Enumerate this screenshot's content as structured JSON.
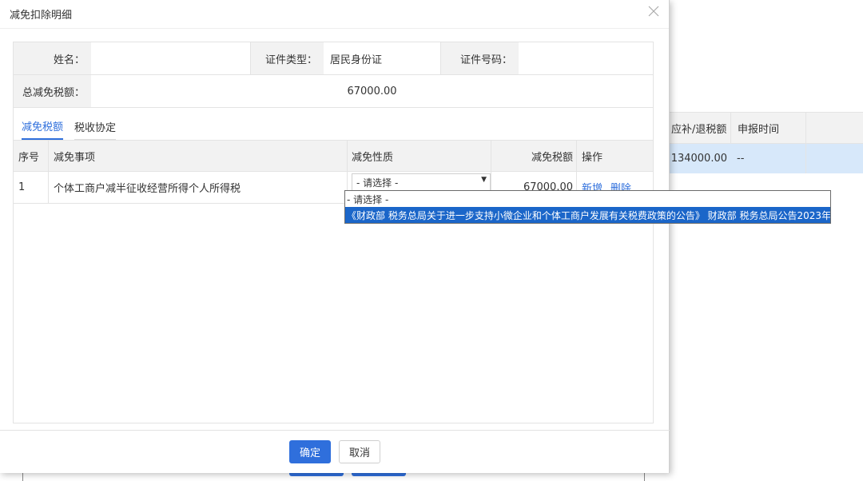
{
  "modal": {
    "title": "减免扣除明细",
    "close_glyph": "╳"
  },
  "info": {
    "name_label": "姓名：",
    "name_value": "",
    "id_type_label": "证件类型：",
    "id_type_value": "居民身份证",
    "id_no_label": "证件号码：",
    "id_no_value": "",
    "total_label": "总减免税额：",
    "total_value": "67000.00"
  },
  "tabs": [
    {
      "label": "减免税额",
      "active": true
    },
    {
      "label": "税收协定",
      "active": false
    }
  ],
  "grid": {
    "headers": {
      "no": "序号",
      "item": "减免事项",
      "type": "减免性质",
      "amount": "减免税额",
      "op": "操作"
    },
    "rows": [
      {
        "no": "1",
        "item": "个体工商户减半征收经营所得个人所得税",
        "type_selected": "- 请选择 -",
        "amount": "67000.00",
        "add_label": "新增",
        "delete_label": "删除"
      }
    ]
  },
  "dropdown": {
    "options": [
      {
        "label": "- 请选择 -",
        "selected": false
      },
      {
        "label": "《财政部 税务总局关于进一步支持小微企业和个体工商户发展有关税费政策的公告》 财政部 税务总局公告2023年",
        "selected": true
      }
    ]
  },
  "footer": {
    "confirm_label": "确定",
    "cancel_label": "取消"
  },
  "background": {
    "headers": [
      "应补/退税额",
      "申报时间"
    ],
    "row": [
      "134000.00",
      "--"
    ]
  },
  "colors": {
    "accent": "#2f6fdc",
    "selected_option": "#1b66c9",
    "header_bg": "#f2f2f2",
    "row_highlight": "#d7e8fa"
  }
}
